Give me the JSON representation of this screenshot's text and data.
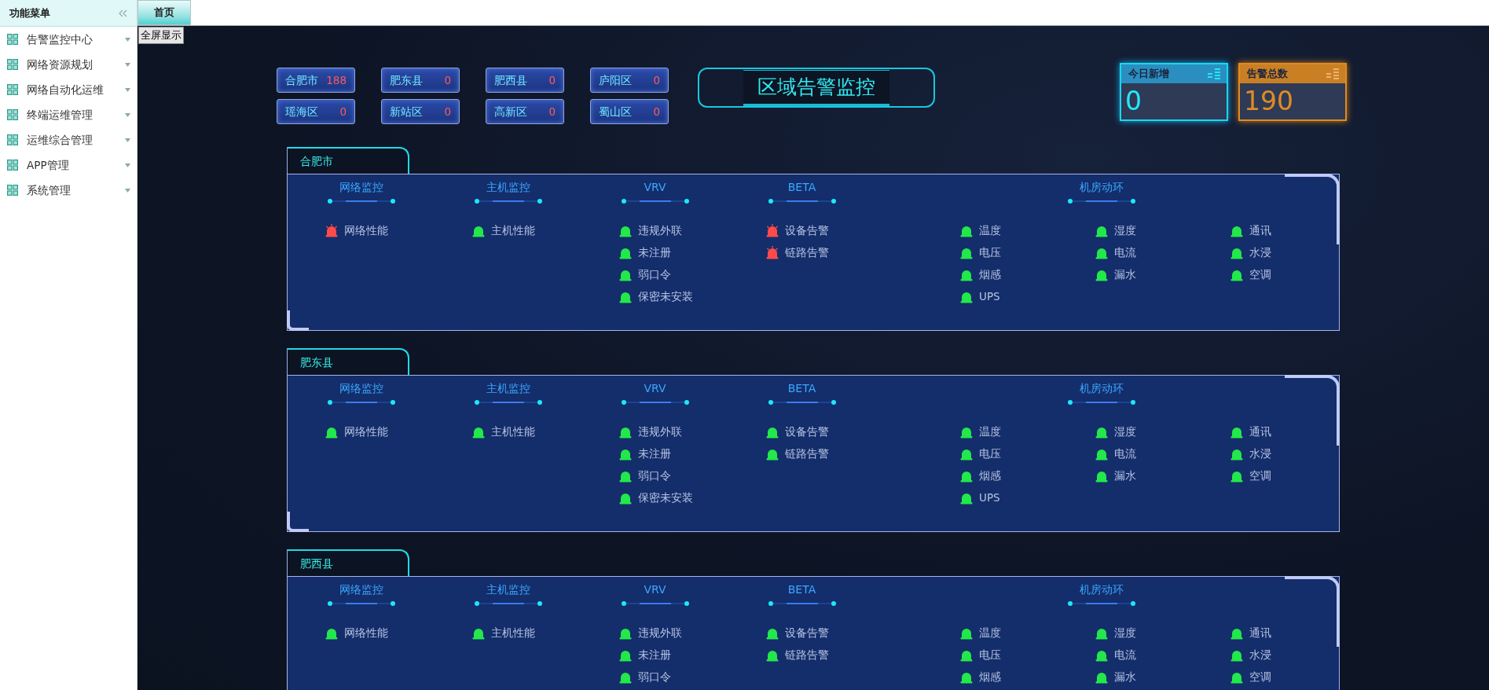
{
  "sidebar": {
    "title": "功能菜单",
    "items": [
      {
        "label": "告警监控中心"
      },
      {
        "label": "网络资源规划"
      },
      {
        "label": "网络自动化运维"
      },
      {
        "label": "终端运维管理"
      },
      {
        "label": "运维综合管理"
      },
      {
        "label": "APP管理"
      },
      {
        "label": "系统管理"
      }
    ]
  },
  "tabs": [
    {
      "label": "首页",
      "selected": true
    }
  ],
  "fullscreen_button": "全屏显示",
  "districts": [
    {
      "name": "合肥市",
      "count": "188"
    },
    {
      "name": "肥东县",
      "count": "0"
    },
    {
      "name": "肥西县",
      "count": "0"
    },
    {
      "name": "庐阳区",
      "count": "0"
    },
    {
      "name": "瑶海区",
      "count": "0"
    },
    {
      "name": "新站区",
      "count": "0"
    },
    {
      "name": "高新区",
      "count": "0"
    },
    {
      "name": "蜀山区",
      "count": "0"
    }
  ],
  "title": "区域告警监控",
  "counters": [
    {
      "kind": "new",
      "label": "今日新增",
      "value": "0"
    },
    {
      "kind": "total",
      "label": "告警总数",
      "value": "190"
    }
  ],
  "panels": [
    {
      "name": "合肥市",
      "groups": [
        {
          "title": "网络监控",
          "columns": [
            [
              {
                "label": "网络性能",
                "alarm": true
              }
            ]
          ]
        },
        {
          "title": "主机监控",
          "columns": [
            [
              {
                "label": "主机性能",
                "alarm": false
              }
            ]
          ]
        },
        {
          "title": "VRV",
          "columns": [
            [
              {
                "label": "违规外联",
                "alarm": false
              },
              {
                "label": "未注册",
                "alarm": false
              },
              {
                "label": "弱口令",
                "alarm": false
              },
              {
                "label": "保密未安装",
                "alarm": false
              }
            ]
          ]
        },
        {
          "title": "BETA",
          "columns": [
            [
              {
                "label": "设备告警",
                "alarm": true
              },
              {
                "label": "链路告警",
                "alarm": true
              }
            ]
          ]
        },
        {
          "title": "机房动环",
          "columns": [
            [
              {
                "label": "温度",
                "alarm": false
              },
              {
                "label": "电压",
                "alarm": false
              },
              {
                "label": "烟感",
                "alarm": false
              },
              {
                "label": "UPS",
                "alarm": false
              }
            ],
            [
              {
                "label": "湿度",
                "alarm": false
              },
              {
                "label": "电流",
                "alarm": false
              },
              {
                "label": "漏水",
                "alarm": false
              }
            ],
            [
              {
                "label": "通讯",
                "alarm": false
              },
              {
                "label": "水浸",
                "alarm": false
              },
              {
                "label": "空调",
                "alarm": false
              }
            ]
          ]
        }
      ]
    },
    {
      "name": "肥东县",
      "groups": [
        {
          "title": "网络监控",
          "columns": [
            [
              {
                "label": "网络性能",
                "alarm": false
              }
            ]
          ]
        },
        {
          "title": "主机监控",
          "columns": [
            [
              {
                "label": "主机性能",
                "alarm": false
              }
            ]
          ]
        },
        {
          "title": "VRV",
          "columns": [
            [
              {
                "label": "违规外联",
                "alarm": false
              },
              {
                "label": "未注册",
                "alarm": false
              },
              {
                "label": "弱口令",
                "alarm": false
              },
              {
                "label": "保密未安装",
                "alarm": false
              }
            ]
          ]
        },
        {
          "title": "BETA",
          "columns": [
            [
              {
                "label": "设备告警",
                "alarm": false
              },
              {
                "label": "链路告警",
                "alarm": false
              }
            ]
          ]
        },
        {
          "title": "机房动环",
          "columns": [
            [
              {
                "label": "温度",
                "alarm": false
              },
              {
                "label": "电压",
                "alarm": false
              },
              {
                "label": "烟感",
                "alarm": false
              },
              {
                "label": "UPS",
                "alarm": false
              }
            ],
            [
              {
                "label": "湿度",
                "alarm": false
              },
              {
                "label": "电流",
                "alarm": false
              },
              {
                "label": "漏水",
                "alarm": false
              }
            ],
            [
              {
                "label": "通讯",
                "alarm": false
              },
              {
                "label": "水浸",
                "alarm": false
              },
              {
                "label": "空调",
                "alarm": false
              }
            ]
          ]
        }
      ]
    },
    {
      "name": "肥西县",
      "groups": [
        {
          "title": "网络监控",
          "columns": [
            [
              {
                "label": "网络性能",
                "alarm": false
              }
            ]
          ]
        },
        {
          "title": "主机监控",
          "columns": [
            [
              {
                "label": "主机性能",
                "alarm": false
              }
            ]
          ]
        },
        {
          "title": "VRV",
          "columns": [
            [
              {
                "label": "违规外联",
                "alarm": false
              },
              {
                "label": "未注册",
                "alarm": false
              },
              {
                "label": "弱口令",
                "alarm": false
              }
            ]
          ]
        },
        {
          "title": "BETA",
          "columns": [
            [
              {
                "label": "设备告警",
                "alarm": false
              },
              {
                "label": "链路告警",
                "alarm": false
              }
            ]
          ]
        },
        {
          "title": "机房动环",
          "columns": [
            [
              {
                "label": "温度",
                "alarm": false
              },
              {
                "label": "电压",
                "alarm": false
              },
              {
                "label": "烟感",
                "alarm": false
              }
            ],
            [
              {
                "label": "湿度",
                "alarm": false
              },
              {
                "label": "电流",
                "alarm": false
              },
              {
                "label": "漏水",
                "alarm": false
              }
            ],
            [
              {
                "label": "通讯",
                "alarm": false
              },
              {
                "label": "水浸",
                "alarm": false
              },
              {
                "label": "空调",
                "alarm": false
              }
            ]
          ]
        }
      ]
    }
  ]
}
